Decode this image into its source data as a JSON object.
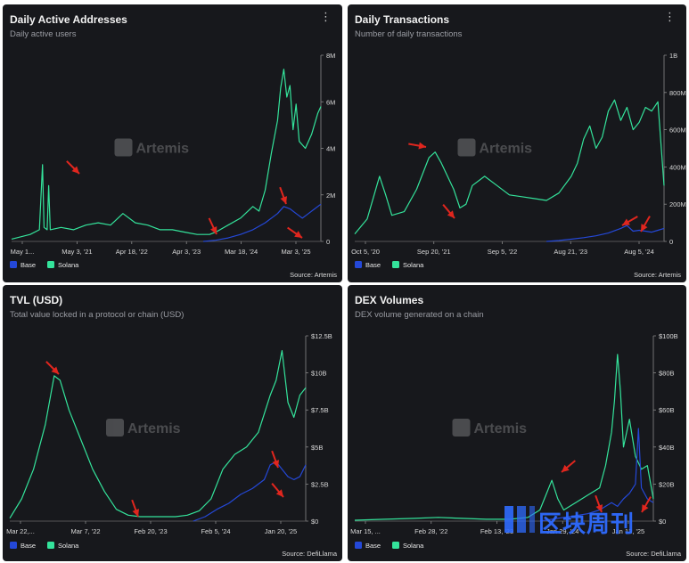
{
  "colors": {
    "base": "#2448d8",
    "solana": "#34e39b",
    "arrow": "#e0261e",
    "bg": "#17181c",
    "axis": "#d8d8d8"
  },
  "icons": {
    "menu": "more-vert-icon",
    "watermark": "artemis-logo-icon"
  },
  "watermark_text": "Artemis",
  "menu_glyph": "⋮",
  "corner_logo_text": "区块周刊",
  "panels": [
    {
      "title": "Daily Active Addresses",
      "subtitle": "Daily active users",
      "source": "Source: Artemis",
      "legend": [
        {
          "name": "Base",
          "color": "#2448d8"
        },
        {
          "name": "Solana",
          "color": "#34e39b"
        }
      ],
      "chart_data": {
        "type": "line",
        "x_ticks": [
          "May 1...",
          "May 3, '21",
          "Apr 18, '22",
          "Apr 3, '23",
          "Mar 18, '24",
          "Mar 3, '25"
        ],
        "y_ticks": [
          "0",
          "2M",
          "4M",
          "6M",
          "8M"
        ],
        "ylim": [
          0,
          8
        ],
        "y_unit": "M",
        "series": [
          {
            "name": "Solana",
            "values": [
              [
                0,
                0.1
              ],
              [
                0.03,
                0.2
              ],
              [
                0.06,
                0.3
              ],
              [
                0.09,
                0.5
              ],
              [
                0.1,
                3.3
              ],
              [
                0.105,
                0.6
              ],
              [
                0.115,
                0.5
              ],
              [
                0.12,
                2.4
              ],
              [
                0.125,
                0.5
              ],
              [
                0.16,
                0.6
              ],
              [
                0.2,
                0.5
              ],
              [
                0.24,
                0.7
              ],
              [
                0.28,
                0.8
              ],
              [
                0.32,
                0.7
              ],
              [
                0.36,
                1.2
              ],
              [
                0.4,
                0.8
              ],
              [
                0.44,
                0.7
              ],
              [
                0.48,
                0.5
              ],
              [
                0.52,
                0.5
              ],
              [
                0.56,
                0.4
              ],
              [
                0.6,
                0.3
              ],
              [
                0.64,
                0.3
              ],
              [
                0.66,
                0.4
              ],
              [
                0.7,
                0.7
              ],
              [
                0.74,
                1.0
              ],
              [
                0.78,
                1.5
              ],
              [
                0.8,
                1.3
              ],
              [
                0.82,
                2.2
              ],
              [
                0.84,
                3.8
              ],
              [
                0.86,
                5.2
              ],
              [
                0.87,
                6.6
              ],
              [
                0.88,
                7.4
              ],
              [
                0.89,
                6.2
              ],
              [
                0.9,
                6.7
              ],
              [
                0.91,
                4.8
              ],
              [
                0.92,
                5.9
              ],
              [
                0.93,
                4.3
              ],
              [
                0.95,
                4.0
              ],
              [
                0.97,
                4.6
              ],
              [
                0.99,
                5.5
              ],
              [
                1,
                5.8
              ]
            ]
          },
          {
            "name": "Base",
            "values": [
              [
                0.62,
                0.0
              ],
              [
                0.66,
                0.05
              ],
              [
                0.7,
                0.15
              ],
              [
                0.74,
                0.3
              ],
              [
                0.78,
                0.5
              ],
              [
                0.82,
                0.8
              ],
              [
                0.86,
                1.2
              ],
              [
                0.88,
                1.5
              ],
              [
                0.9,
                1.4
              ],
              [
                0.92,
                1.2
              ],
              [
                0.94,
                1.0
              ],
              [
                0.96,
                1.2
              ],
              [
                0.98,
                1.4
              ],
              [
                1,
                1.6
              ]
            ]
          }
        ]
      }
    },
    {
      "title": "Daily Transactions",
      "subtitle": "Number of daily transactions",
      "source": "Source: Artemis",
      "legend": [
        {
          "name": "Base",
          "color": "#2448d8"
        },
        {
          "name": "Solana",
          "color": "#34e39b"
        }
      ],
      "chart_data": {
        "type": "line",
        "x_ticks": [
          "Oct 5, '20",
          "Sep 20, '21",
          "Sep 5, '22",
          "Aug 21, '23",
          "Aug 5, '24"
        ],
        "y_ticks": [
          "0",
          "200M",
          "400M",
          "600M",
          "800M",
          "1B"
        ],
        "ylim": [
          0,
          1000
        ],
        "y_unit": "M",
        "series": [
          {
            "name": "Solana",
            "values": [
              [
                0,
                40
              ],
              [
                0.04,
                120
              ],
              [
                0.08,
                350
              ],
              [
                0.1,
                250
              ],
              [
                0.12,
                140
              ],
              [
                0.16,
                160
              ],
              [
                0.2,
                280
              ],
              [
                0.24,
                450
              ],
              [
                0.26,
                480
              ],
              [
                0.28,
                420
              ],
              [
                0.3,
                350
              ],
              [
                0.32,
                280
              ],
              [
                0.34,
                180
              ],
              [
                0.36,
                200
              ],
              [
                0.38,
                300
              ],
              [
                0.42,
                350
              ],
              [
                0.46,
                300
              ],
              [
                0.5,
                250
              ],
              [
                0.54,
                240
              ],
              [
                0.58,
                230
              ],
              [
                0.62,
                220
              ],
              [
                0.66,
                260
              ],
              [
                0.7,
                350
              ],
              [
                0.72,
                420
              ],
              [
                0.74,
                550
              ],
              [
                0.76,
                620
              ],
              [
                0.78,
                500
              ],
              [
                0.8,
                560
              ],
              [
                0.82,
                700
              ],
              [
                0.84,
                760
              ],
              [
                0.86,
                650
              ],
              [
                0.88,
                720
              ],
              [
                0.9,
                600
              ],
              [
                0.92,
                640
              ],
              [
                0.94,
                720
              ],
              [
                0.96,
                700
              ],
              [
                0.98,
                750
              ],
              [
                1,
                300
              ]
            ]
          },
          {
            "name": "Base",
            "values": [
              [
                0.62,
                0
              ],
              [
                0.66,
                5
              ],
              [
                0.7,
                12
              ],
              [
                0.74,
                20
              ],
              [
                0.78,
                30
              ],
              [
                0.82,
                45
              ],
              [
                0.86,
                70
              ],
              [
                0.88,
                85
              ],
              [
                0.9,
                55
              ],
              [
                0.92,
                60
              ],
              [
                0.94,
                55
              ],
              [
                0.96,
                50
              ],
              [
                0.98,
                60
              ],
              [
                1,
                70
              ]
            ]
          }
        ]
      }
    },
    {
      "title": "TVL (USD)",
      "subtitle": "Total value locked in a protocol or chain (USD)",
      "source": "Source: DefiLlama",
      "legend": [
        {
          "name": "Base",
          "color": "#2448d8"
        },
        {
          "name": "Solana",
          "color": "#34e39b"
        }
      ],
      "chart_data": {
        "type": "line",
        "x_ticks": [
          "Mar 22,...",
          "Mar 7, '22",
          "Feb 20, '23",
          "Feb 5, '24",
          "Jan 20, '25"
        ],
        "y_ticks": [
          "$0",
          "$2.5B",
          "$5B",
          "$7.5B",
          "$10B",
          "$12.5B"
        ],
        "ylim": [
          0,
          12.5
        ],
        "y_unit": "B",
        "series": [
          {
            "name": "Solana",
            "values": [
              [
                0,
                0.2
              ],
              [
                0.04,
                1.5
              ],
              [
                0.08,
                3.5
              ],
              [
                0.12,
                6.5
              ],
              [
                0.15,
                9.8
              ],
              [
                0.17,
                9.5
              ],
              [
                0.2,
                7.5
              ],
              [
                0.24,
                5.5
              ],
              [
                0.28,
                3.5
              ],
              [
                0.32,
                2.0
              ],
              [
                0.36,
                0.8
              ],
              [
                0.4,
                0.4
              ],
              [
                0.44,
                0.3
              ],
              [
                0.48,
                0.3
              ],
              [
                0.52,
                0.3
              ],
              [
                0.56,
                0.3
              ],
              [
                0.6,
                0.4
              ],
              [
                0.64,
                0.7
              ],
              [
                0.68,
                1.5
              ],
              [
                0.72,
                3.5
              ],
              [
                0.76,
                4.5
              ],
              [
                0.8,
                5.0
              ],
              [
                0.84,
                6.0
              ],
              [
                0.88,
                8.5
              ],
              [
                0.9,
                9.5
              ],
              [
                0.92,
                11.5
              ],
              [
                0.94,
                8.0
              ],
              [
                0.96,
                7.0
              ],
              [
                0.98,
                8.5
              ],
              [
                1,
                9.0
              ]
            ]
          },
          {
            "name": "Base",
            "values": [
              [
                0.62,
                0.0
              ],
              [
                0.66,
                0.3
              ],
              [
                0.7,
                0.8
              ],
              [
                0.74,
                1.2
              ],
              [
                0.78,
                1.8
              ],
              [
                0.82,
                2.2
              ],
              [
                0.86,
                2.8
              ],
              [
                0.88,
                3.8
              ],
              [
                0.9,
                4.0
              ],
              [
                0.92,
                3.5
              ],
              [
                0.94,
                3.0
              ],
              [
                0.96,
                2.8
              ],
              [
                0.98,
                3.0
              ],
              [
                1,
                3.8
              ]
            ]
          }
        ]
      }
    },
    {
      "title": "DEX Volumes",
      "subtitle": "DEX volume generated on a chain",
      "source": "Source: DefiLlama",
      "legend": [
        {
          "name": "Base",
          "color": "#2448d8"
        },
        {
          "name": "Solana",
          "color": "#34e39b"
        }
      ],
      "chart_data": {
        "type": "line",
        "x_ticks": [
          "Mar 15, ...",
          "Feb 28, '22",
          "Feb 13, '23",
          "Jan 29, '24",
          "Jan 13, '25"
        ],
        "y_ticks": [
          "$0",
          "$20B",
          "$40B",
          "$60B",
          "$80B",
          "$100B"
        ],
        "ylim": [
          0,
          100
        ],
        "y_unit": "B",
        "series": [
          {
            "name": "Solana",
            "values": [
              [
                0,
                0.5
              ],
              [
                0.1,
                1
              ],
              [
                0.2,
                1.5
              ],
              [
                0.28,
                2
              ],
              [
                0.36,
                1.5
              ],
              [
                0.44,
                1
              ],
              [
                0.52,
                1
              ],
              [
                0.58,
                2
              ],
              [
                0.62,
                6
              ],
              [
                0.64,
                14
              ],
              [
                0.66,
                22
              ],
              [
                0.68,
                12
              ],
              [
                0.7,
                6
              ],
              [
                0.74,
                10
              ],
              [
                0.78,
                14
              ],
              [
                0.82,
                18
              ],
              [
                0.84,
                30
              ],
              [
                0.86,
                48
              ],
              [
                0.87,
                65
              ],
              [
                0.88,
                90
              ],
              [
                0.89,
                70
              ],
              [
                0.9,
                40
              ],
              [
                0.92,
                55
              ],
              [
                0.94,
                35
              ],
              [
                0.96,
                28
              ],
              [
                0.98,
                30
              ],
              [
                1,
                12
              ]
            ]
          },
          {
            "name": "Base",
            "values": [
              [
                0.62,
                0
              ],
              [
                0.66,
                1
              ],
              [
                0.7,
                2
              ],
              [
                0.74,
                3
              ],
              [
                0.78,
                4
              ],
              [
                0.82,
                6
              ],
              [
                0.86,
                10
              ],
              [
                0.88,
                8
              ],
              [
                0.9,
                12
              ],
              [
                0.92,
                15
              ],
              [
                0.94,
                20
              ],
              [
                0.95,
                50
              ],
              [
                0.96,
                18
              ],
              [
                0.98,
                12
              ],
              [
                1,
                10
              ]
            ]
          }
        ]
      }
    }
  ]
}
